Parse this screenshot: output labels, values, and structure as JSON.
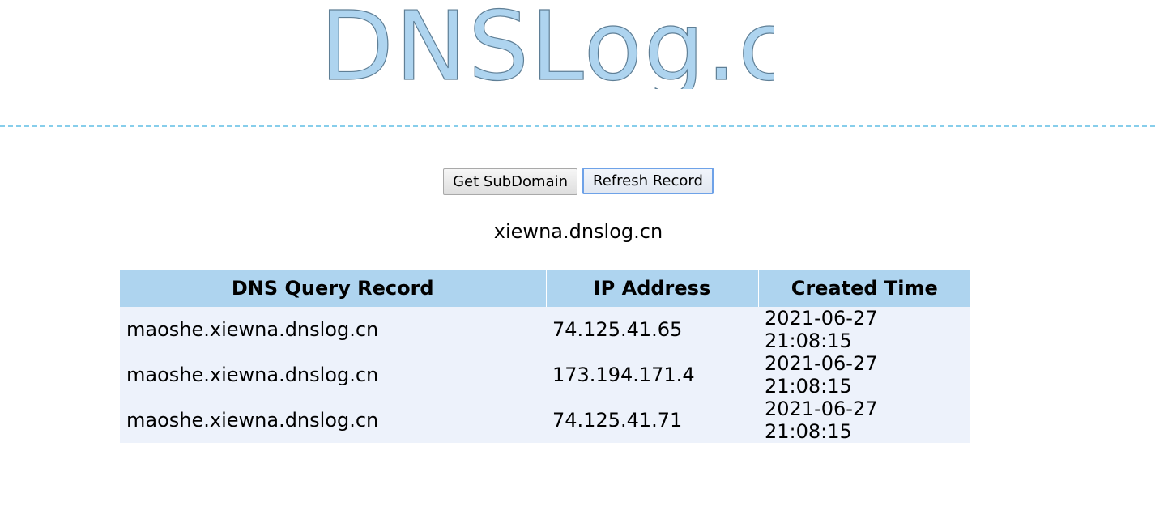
{
  "logo": {
    "text": "DNSLog.cn"
  },
  "toolbar": {
    "get_subdomain_label": "Get SubDomain",
    "refresh_record_label": "Refresh Record"
  },
  "subdomain": "xiewna.dnslog.cn",
  "table": {
    "headers": [
      "DNS Query Record",
      "IP Address",
      "Created Time"
    ],
    "rows": [
      [
        "maoshe.xiewna.dnslog.cn",
        "74.125.41.65",
        "2021-06-27 21:08:15"
      ],
      [
        "maoshe.xiewna.dnslog.cn",
        "173.194.171.4",
        "2021-06-27 21:08:15"
      ],
      [
        "maoshe.xiewna.dnslog.cn",
        "74.125.41.71",
        "2021-06-27 21:08:15"
      ]
    ]
  },
  "colors": {
    "logo_fill": "#aed4ef",
    "divider": "#87ceeb",
    "header_bg": "#aed4ef",
    "row_bg": "#edf2fb",
    "focus_ring": "#6ea2e8"
  }
}
